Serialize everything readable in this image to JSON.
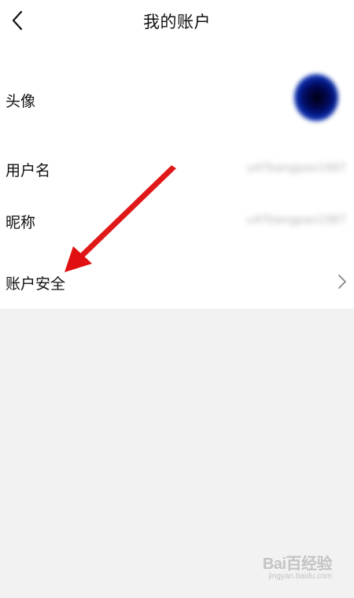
{
  "header": {
    "title": "我的账户",
    "back_icon": "chevron-left-icon"
  },
  "rows": {
    "avatar": {
      "label": "头像"
    },
    "username": {
      "label": "用户名",
      "value": "u4fbangpao1987"
    },
    "nickname": {
      "label": "昵称",
      "value": "u4fbangpao1987"
    },
    "security": {
      "label": "账户安全",
      "chevron_icon": "chevron-right-icon"
    }
  },
  "annotation": {
    "arrow_color": "#e01010"
  },
  "watermark": {
    "logo": "Bai百经验",
    "url": "jingyan.baidu.com"
  }
}
